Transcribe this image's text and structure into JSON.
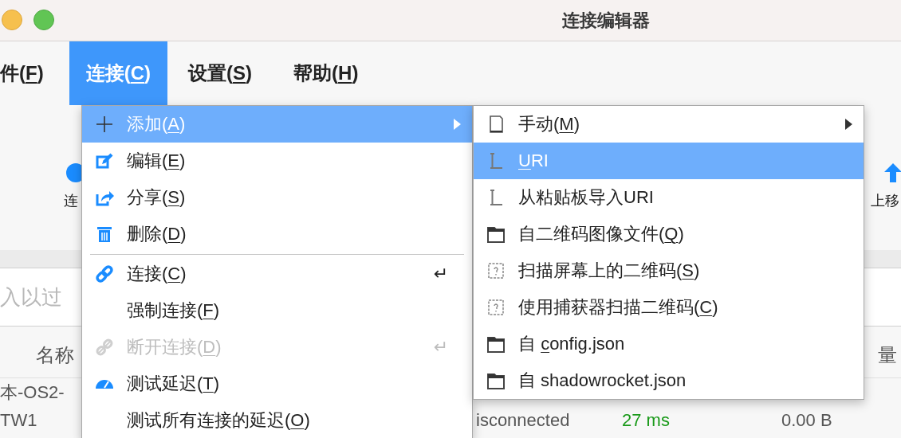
{
  "window": {
    "title": "连接编辑器"
  },
  "menubar": {
    "items": [
      {
        "text": "件(",
        "mnemonic": "F",
        "rest": ")",
        "selected": false
      },
      {
        "text": "连接(",
        "mnemonic": "C",
        "rest": ")",
        "selected": true
      },
      {
        "text": "设置(",
        "mnemonic": "S",
        "rest": ")",
        "selected": false
      },
      {
        "text": "帮助(",
        "mnemonic": "H",
        "rest": ")",
        "selected": false
      }
    ]
  },
  "toolbar": {
    "buttons": [
      {
        "label": "连"
      },
      {
        "label": "上移"
      }
    ]
  },
  "search": {
    "placeholder": "入以过"
  },
  "table": {
    "columns": [
      "名称",
      "量"
    ],
    "rows": [
      [
        "本-OS2-"
      ],
      [
        "TW1",
        "isconnected",
        "27 ms",
        "0.00 B"
      ]
    ]
  },
  "menus": [
    {
      "items": [
        {
          "kind": "item",
          "text": "添加(",
          "mnemonic": "A",
          "rest": ")",
          "submenu": true,
          "selected": true,
          "disabled": false
        },
        {
          "kind": "item",
          "text": "编辑(",
          "mnemonic": "E",
          "rest": ")",
          "submenu": false,
          "selected": false,
          "disabled": false
        },
        {
          "kind": "item",
          "text": "分享(",
          "mnemonic": "S",
          "rest": ")",
          "submenu": false,
          "selected": false,
          "disabled": false
        },
        {
          "kind": "item",
          "text": "删除(",
          "mnemonic": "D",
          "rest": ")",
          "submenu": false,
          "selected": false,
          "disabled": false
        },
        {
          "kind": "separator"
        },
        {
          "kind": "item",
          "text": "连接(",
          "mnemonic": "C",
          "rest": ")",
          "shortcut": "↵",
          "submenu": false,
          "selected": false,
          "disabled": false
        },
        {
          "kind": "item",
          "text": "强制连接(",
          "mnemonic": "F",
          "rest": ")",
          "submenu": false,
          "selected": false,
          "disabled": false
        },
        {
          "kind": "item",
          "text": "断开连接(",
          "mnemonic": "D",
          "rest": ")",
          "shortcut": "↵",
          "submenu": false,
          "selected": false,
          "disabled": true
        },
        {
          "kind": "item",
          "text": "测试延迟(",
          "mnemonic": "T",
          "rest": ")",
          "submenu": false,
          "selected": false,
          "disabled": false
        },
        {
          "kind": "item",
          "text": "测试所有连接的延迟(",
          "mnemonic": "O",
          "rest": ")",
          "submenu": false,
          "selected": false,
          "disabled": false
        }
      ]
    },
    {
      "items": [
        {
          "kind": "item",
          "text": "手动(",
          "mnemonic": "M",
          "rest": ")",
          "submenu": true,
          "selected": false,
          "disabled": false
        },
        {
          "kind": "item",
          "mnemonic": "U",
          "rest": "RI",
          "submenu": false,
          "selected": true,
          "disabled": false
        },
        {
          "kind": "item",
          "text": "从粘贴板导入URI",
          "submenu": false,
          "selected": false,
          "disabled": false
        },
        {
          "kind": "item",
          "text": "自二维码图像文件(",
          "mnemonic": "Q",
          "rest": ")",
          "submenu": false,
          "selected": false,
          "disabled": false
        },
        {
          "kind": "item",
          "text": "扫描屏幕上的二维码(",
          "mnemonic": "S",
          "rest": ")",
          "submenu": false,
          "selected": false,
          "disabled": false
        },
        {
          "kind": "item",
          "text": "使用捕获器扫描二维码(",
          "mnemonic": "C",
          "rest": ")",
          "submenu": false,
          "selected": false,
          "disabled": false
        },
        {
          "kind": "item",
          "text": "自 ",
          "mnemonic": "c",
          "rest": "onfig.json",
          "submenu": false,
          "selected": false,
          "disabled": false
        },
        {
          "kind": "item",
          "text": "自 shadowrocket.json",
          "submenu": false,
          "selected": false,
          "disabled": false
        }
      ]
    }
  ]
}
